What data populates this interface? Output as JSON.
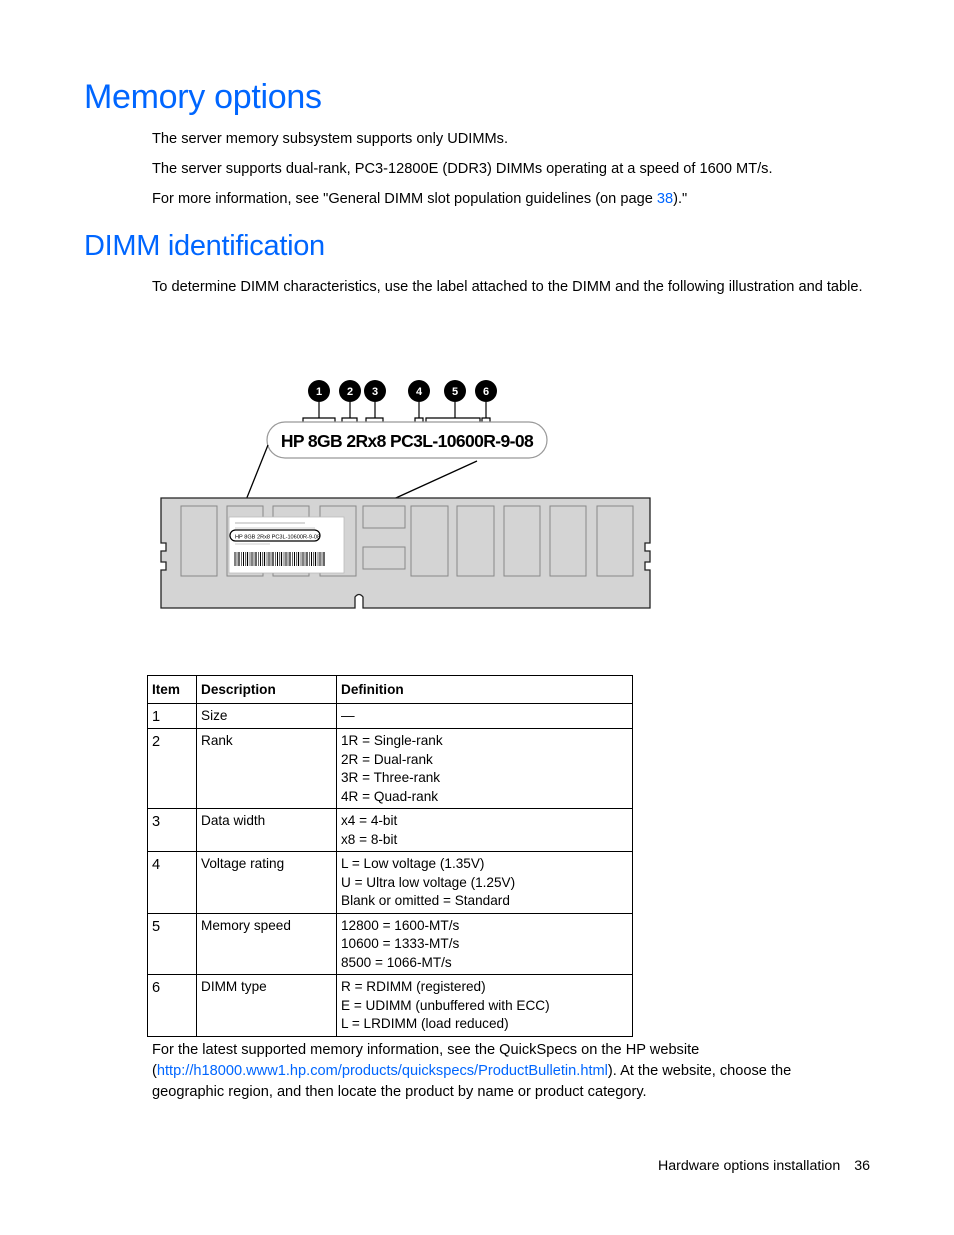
{
  "section1": {
    "title": "Memory options",
    "paragraphs": [
      "The server memory subsystem supports only UDIMMs.",
      "The server supports dual-rank, PC3-12800E (DDR3) DIMMs operating at a speed of 1600 MT/s."
    ],
    "more_info": {
      "prefix": "For more information, see \"General DIMM slot population guidelines (on page ",
      "link": "38",
      "suffix": ").\""
    }
  },
  "section2": {
    "title": "DIMM identification",
    "intro": "To determine DIMM characteristics, use the label attached to the DIMM and the following illustration and table."
  },
  "illustration": {
    "label_text": "HP 8GB 2Rx8 PC3L-10600R-9-08",
    "small_label_text": "HP 8GB 2Rx8 PC3L-10600R-9-08",
    "callouts": [
      "1",
      "2",
      "3",
      "4",
      "5",
      "6"
    ]
  },
  "table": {
    "headers": [
      "Item",
      "Description",
      "Definition"
    ],
    "rows": [
      {
        "item": "1",
        "description": "Size",
        "definition": [
          "—"
        ]
      },
      {
        "item": "2",
        "description": "Rank",
        "definition": [
          "1R = Single-rank",
          "2R = Dual-rank",
          "3R = Three-rank",
          "4R = Quad-rank"
        ]
      },
      {
        "item": "3",
        "description": "Data width",
        "definition": [
          "x4 = 4-bit",
          "x8 = 8-bit"
        ]
      },
      {
        "item": "4",
        "description": "Voltage rating",
        "definition": [
          "L = Low voltage (1.35V)",
          "U = Ultra low voltage (1.25V)",
          "Blank or omitted = Standard"
        ]
      },
      {
        "item": "5",
        "description": "Memory speed",
        "definition": [
          "12800 = 1600-MT/s",
          "10600 = 1333-MT/s",
          "8500 = 1066-MT/s"
        ]
      },
      {
        "item": "6",
        "description": "DIMM type",
        "definition": [
          "R = RDIMM (registered)",
          "E = UDIMM (unbuffered with ECC)",
          "L = LRDIMM (load reduced)"
        ]
      }
    ]
  },
  "closing": {
    "line1": "For the latest supported memory information, see the QuickSpecs on the HP website",
    "open_paren": "(",
    "url": "http://h18000.www1.hp.com/products/quickspecs/ProductBulletin.html",
    "after_url": "). At the website, choose the",
    "line3": "geographic region, and then locate the product by name or product category."
  },
  "footer": {
    "section": "Hardware options installation",
    "page": "36"
  },
  "colors": {
    "heading": "#0066ff",
    "link": "#0066ff",
    "dimm_fill": "#d4d4d4"
  }
}
